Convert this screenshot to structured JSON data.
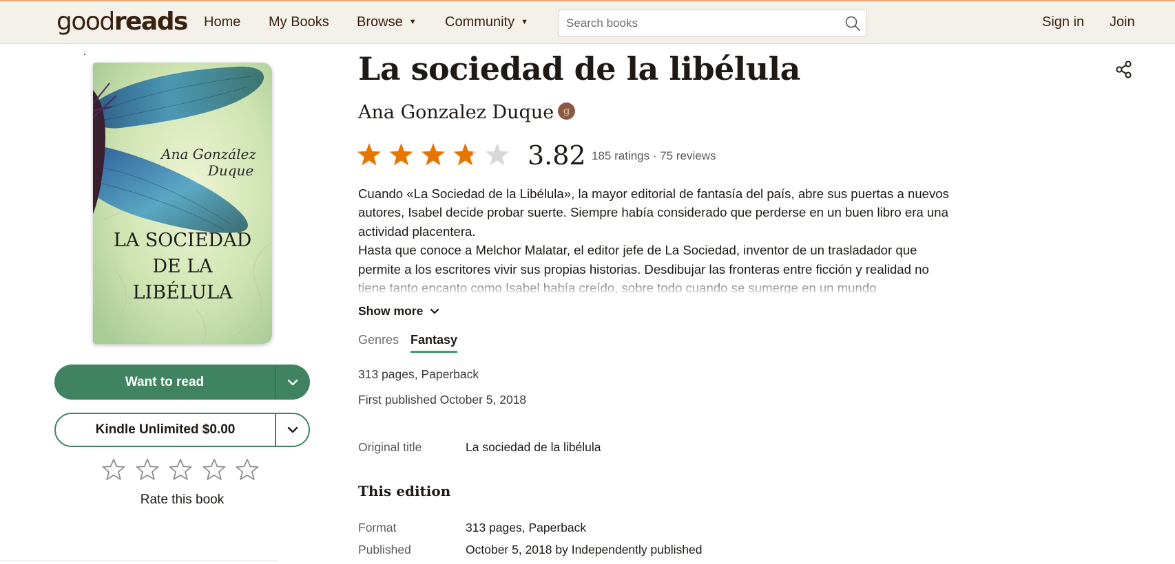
{
  "header": {
    "logo_light": "good",
    "logo_bold": "reads",
    "nav": {
      "home": "Home",
      "my_books": "My Books",
      "browse": "Browse",
      "community": "Community"
    },
    "search_placeholder": "Search books",
    "sign_in": "Sign in",
    "join": "Join"
  },
  "book": {
    "title": "La sociedad de la libélula",
    "author": "Ana Gonzalez Duque",
    "author_badge": "g",
    "average_rating": "3.82",
    "rating_value": 3.82,
    "rating_max": 5,
    "ratings_text": "185 ratings · 75 reviews",
    "description": [
      "Cuando «La Sociedad de la Libélula», la mayor editorial de fantasía del país, abre sus puertas a nuevos autores, Isabel decide probar suerte. Siempre había considerado que perderse en un buen libro era una actividad placentera.",
      "Hasta que conoce a Melchor Malatar, el editor jefe de La Sociedad, inventor de un trasladador que permite a los escritores vivir sus propias historias. Desdibujar las fronteras entre ficción y realidad no tiene tanto encanto como Isabel había creído, sobre todo cuando se sumerge en un mundo"
    ],
    "show_more": "Show more",
    "genres_label": "Genres",
    "genres": [
      "Fantasy"
    ],
    "pages_format": "313 pages, Paperback",
    "first_published": "First published October 5, 2018",
    "original_title_label": "Original title",
    "original_title": "La sociedad de la libélula",
    "edition_heading": "This edition",
    "format_label": "Format",
    "format_value": "313 pages, Paperback",
    "published_label": "Published",
    "published_value": "October 5, 2018 by Independently published"
  },
  "cover": {
    "author_line1": "Ana González",
    "author_line2": "Duque",
    "title_line1": "LA SOCIEDAD",
    "title_line2": "DE LA",
    "title_line3": "LIBÉLULA"
  },
  "actions": {
    "want_to_read": "Want to read",
    "kindle": "Kindle Unlimited $0.00",
    "rate_label": "Rate this book"
  },
  "colors": {
    "star_filled": "#e87400",
    "star_empty": "#d8d8d8",
    "primary_green": "#3f8363",
    "genre_underline": "#409d69",
    "header_bg": "#f4f1ea"
  }
}
